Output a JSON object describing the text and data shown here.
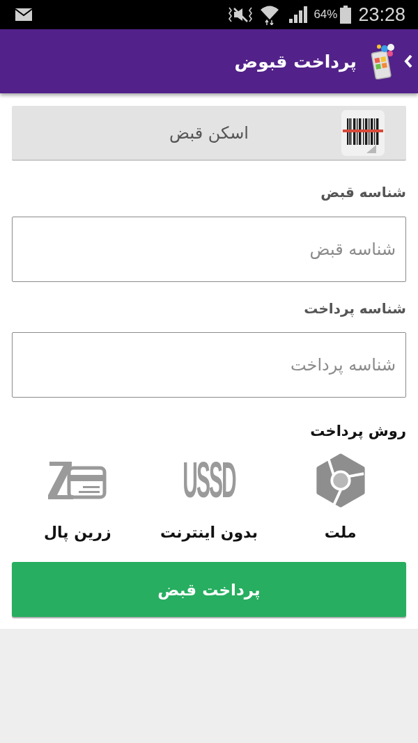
{
  "status_bar": {
    "battery": "64%",
    "time": "23:28"
  },
  "app_bar": {
    "title": "پرداخت قبوض"
  },
  "scan_button": {
    "label": "اسکن قبض"
  },
  "fields": [
    {
      "label": "شناسه قبض",
      "placeholder": "شناسه قبض"
    },
    {
      "label": "شناسه پرداخت",
      "placeholder": "شناسه پرداخت"
    }
  ],
  "payment_methods": {
    "title": "روش پرداخت",
    "options": [
      {
        "kind": "mellat",
        "label": "ملت"
      },
      {
        "kind": "ussd",
        "logo_text": "USSD",
        "label": "بدون اینترنت"
      },
      {
        "kind": "zarinpal",
        "label": "زرین پال"
      }
    ]
  },
  "submit_button": {
    "label": "پرداخت قبض"
  }
}
